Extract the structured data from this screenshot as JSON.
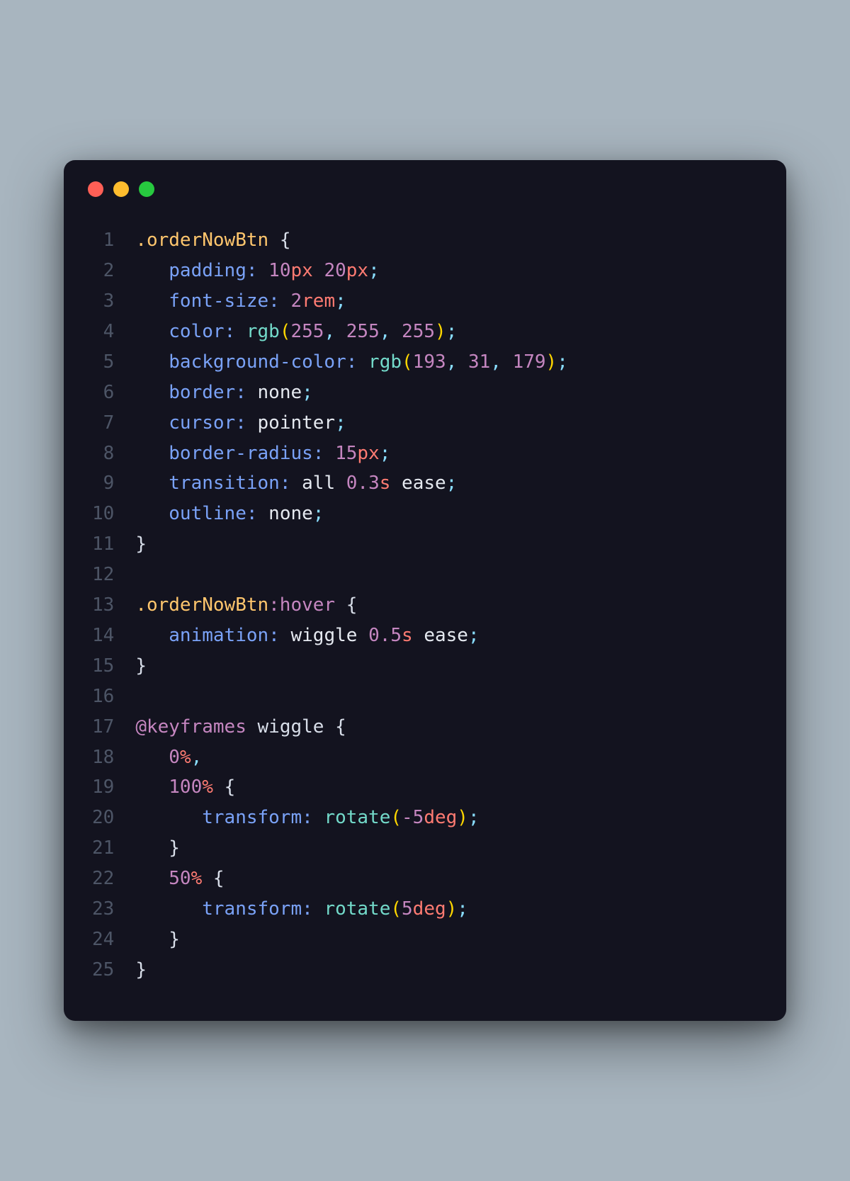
{
  "window": {
    "traffic_lights": [
      "red",
      "yellow",
      "green"
    ]
  },
  "code": {
    "line_numbers": [
      "1",
      "2",
      "3",
      "4",
      "5",
      "6",
      "7",
      "8",
      "9",
      "10",
      "11",
      "12",
      "13",
      "14",
      "15",
      "16",
      "17",
      "18",
      "19",
      "20",
      "21",
      "22",
      "23",
      "24",
      "25"
    ],
    "lines": [
      [
        {
          "t": "selector",
          "v": ".orderNowBtn"
        },
        {
          "t": "plain",
          "v": " "
        },
        {
          "t": "brace",
          "v": "{"
        }
      ],
      [
        {
          "t": "plain",
          "v": "   "
        },
        {
          "t": "property",
          "v": "padding"
        },
        {
          "t": "colon",
          "v": ":"
        },
        {
          "t": "plain",
          "v": " "
        },
        {
          "t": "number",
          "v": "10"
        },
        {
          "t": "unit",
          "v": "px"
        },
        {
          "t": "plain",
          "v": " "
        },
        {
          "t": "number",
          "v": "20"
        },
        {
          "t": "unit",
          "v": "px"
        },
        {
          "t": "semicolon",
          "v": ";"
        }
      ],
      [
        {
          "t": "plain",
          "v": "   "
        },
        {
          "t": "property",
          "v": "font-size"
        },
        {
          "t": "colon",
          "v": ":"
        },
        {
          "t": "plain",
          "v": " "
        },
        {
          "t": "number",
          "v": "2"
        },
        {
          "t": "unit",
          "v": "rem"
        },
        {
          "t": "semicolon",
          "v": ";"
        }
      ],
      [
        {
          "t": "plain",
          "v": "   "
        },
        {
          "t": "property",
          "v": "color"
        },
        {
          "t": "colon",
          "v": ":"
        },
        {
          "t": "plain",
          "v": " "
        },
        {
          "t": "func",
          "v": "rgb"
        },
        {
          "t": "paren",
          "v": "("
        },
        {
          "t": "number",
          "v": "255"
        },
        {
          "t": "comma",
          "v": ", "
        },
        {
          "t": "number",
          "v": "255"
        },
        {
          "t": "comma",
          "v": ", "
        },
        {
          "t": "number",
          "v": "255"
        },
        {
          "t": "paren",
          "v": ")"
        },
        {
          "t": "semicolon",
          "v": ";"
        }
      ],
      [
        {
          "t": "plain",
          "v": "   "
        },
        {
          "t": "property",
          "v": "background-color"
        },
        {
          "t": "colon",
          "v": ":"
        },
        {
          "t": "plain",
          "v": " "
        },
        {
          "t": "func",
          "v": "rgb"
        },
        {
          "t": "paren",
          "v": "("
        },
        {
          "t": "number",
          "v": "193"
        },
        {
          "t": "comma",
          "v": ", "
        },
        {
          "t": "number",
          "v": "31"
        },
        {
          "t": "comma",
          "v": ", "
        },
        {
          "t": "number",
          "v": "179"
        },
        {
          "t": "paren",
          "v": ")"
        },
        {
          "t": "semicolon",
          "v": ";"
        }
      ],
      [
        {
          "t": "plain",
          "v": "   "
        },
        {
          "t": "property",
          "v": "border"
        },
        {
          "t": "colon",
          "v": ":"
        },
        {
          "t": "plain",
          "v": " "
        },
        {
          "t": "value",
          "v": "none"
        },
        {
          "t": "semicolon",
          "v": ";"
        }
      ],
      [
        {
          "t": "plain",
          "v": "   "
        },
        {
          "t": "property",
          "v": "cursor"
        },
        {
          "t": "colon",
          "v": ":"
        },
        {
          "t": "plain",
          "v": " "
        },
        {
          "t": "value",
          "v": "pointer"
        },
        {
          "t": "semicolon",
          "v": ";"
        }
      ],
      [
        {
          "t": "plain",
          "v": "   "
        },
        {
          "t": "property",
          "v": "border-radius"
        },
        {
          "t": "colon",
          "v": ":"
        },
        {
          "t": "plain",
          "v": " "
        },
        {
          "t": "number",
          "v": "15"
        },
        {
          "t": "unit",
          "v": "px"
        },
        {
          "t": "semicolon",
          "v": ";"
        }
      ],
      [
        {
          "t": "plain",
          "v": "   "
        },
        {
          "t": "property",
          "v": "transition"
        },
        {
          "t": "colon",
          "v": ":"
        },
        {
          "t": "plain",
          "v": " "
        },
        {
          "t": "value",
          "v": "all"
        },
        {
          "t": "plain",
          "v": " "
        },
        {
          "t": "number",
          "v": "0.3"
        },
        {
          "t": "unit",
          "v": "s"
        },
        {
          "t": "plain",
          "v": " "
        },
        {
          "t": "value",
          "v": "ease"
        },
        {
          "t": "semicolon",
          "v": ";"
        }
      ],
      [
        {
          "t": "plain",
          "v": "   "
        },
        {
          "t": "property",
          "v": "outline"
        },
        {
          "t": "colon",
          "v": ":"
        },
        {
          "t": "plain",
          "v": " "
        },
        {
          "t": "value",
          "v": "none"
        },
        {
          "t": "semicolon",
          "v": ";"
        }
      ],
      [
        {
          "t": "brace",
          "v": "}"
        }
      ],
      [],
      [
        {
          "t": "selector",
          "v": ".orderNowBtn"
        },
        {
          "t": "pseudo",
          "v": ":hover"
        },
        {
          "t": "plain",
          "v": " "
        },
        {
          "t": "brace",
          "v": "{"
        }
      ],
      [
        {
          "t": "plain",
          "v": "   "
        },
        {
          "t": "property",
          "v": "animation"
        },
        {
          "t": "colon",
          "v": ":"
        },
        {
          "t": "plain",
          "v": " "
        },
        {
          "t": "value",
          "v": "wiggle"
        },
        {
          "t": "plain",
          "v": " "
        },
        {
          "t": "number",
          "v": "0.5"
        },
        {
          "t": "unit",
          "v": "s"
        },
        {
          "t": "plain",
          "v": " "
        },
        {
          "t": "value",
          "v": "ease"
        },
        {
          "t": "semicolon",
          "v": ";"
        }
      ],
      [
        {
          "t": "brace",
          "v": "}"
        }
      ],
      [],
      [
        {
          "t": "keyword",
          "v": "@keyframes"
        },
        {
          "t": "plain",
          "v": " "
        },
        {
          "t": "ident",
          "v": "wiggle"
        },
        {
          "t": "plain",
          "v": " "
        },
        {
          "t": "brace",
          "v": "{"
        }
      ],
      [
        {
          "t": "plain",
          "v": "   "
        },
        {
          "t": "number",
          "v": "0"
        },
        {
          "t": "unit",
          "v": "%"
        },
        {
          "t": "comma",
          "v": ","
        }
      ],
      [
        {
          "t": "plain",
          "v": "   "
        },
        {
          "t": "number",
          "v": "100"
        },
        {
          "t": "unit",
          "v": "%"
        },
        {
          "t": "plain",
          "v": " "
        },
        {
          "t": "brace",
          "v": "{"
        }
      ],
      [
        {
          "t": "plain",
          "v": "      "
        },
        {
          "t": "property",
          "v": "transform"
        },
        {
          "t": "colon",
          "v": ":"
        },
        {
          "t": "plain",
          "v": " "
        },
        {
          "t": "func",
          "v": "rotate"
        },
        {
          "t": "paren",
          "v": "("
        },
        {
          "t": "number",
          "v": "-5"
        },
        {
          "t": "unit",
          "v": "deg"
        },
        {
          "t": "paren",
          "v": ")"
        },
        {
          "t": "semicolon",
          "v": ";"
        }
      ],
      [
        {
          "t": "plain",
          "v": "   "
        },
        {
          "t": "brace",
          "v": "}"
        }
      ],
      [
        {
          "t": "plain",
          "v": "   "
        },
        {
          "t": "number",
          "v": "50"
        },
        {
          "t": "unit",
          "v": "%"
        },
        {
          "t": "plain",
          "v": " "
        },
        {
          "t": "brace",
          "v": "{"
        }
      ],
      [
        {
          "t": "plain",
          "v": "      "
        },
        {
          "t": "property",
          "v": "transform"
        },
        {
          "t": "colon",
          "v": ":"
        },
        {
          "t": "plain",
          "v": " "
        },
        {
          "t": "func",
          "v": "rotate"
        },
        {
          "t": "paren",
          "v": "("
        },
        {
          "t": "number",
          "v": "5"
        },
        {
          "t": "unit",
          "v": "deg"
        },
        {
          "t": "paren",
          "v": ")"
        },
        {
          "t": "semicolon",
          "v": ";"
        }
      ],
      [
        {
          "t": "plain",
          "v": "   "
        },
        {
          "t": "brace",
          "v": "}"
        }
      ],
      [
        {
          "t": "brace",
          "v": "}"
        }
      ]
    ]
  }
}
